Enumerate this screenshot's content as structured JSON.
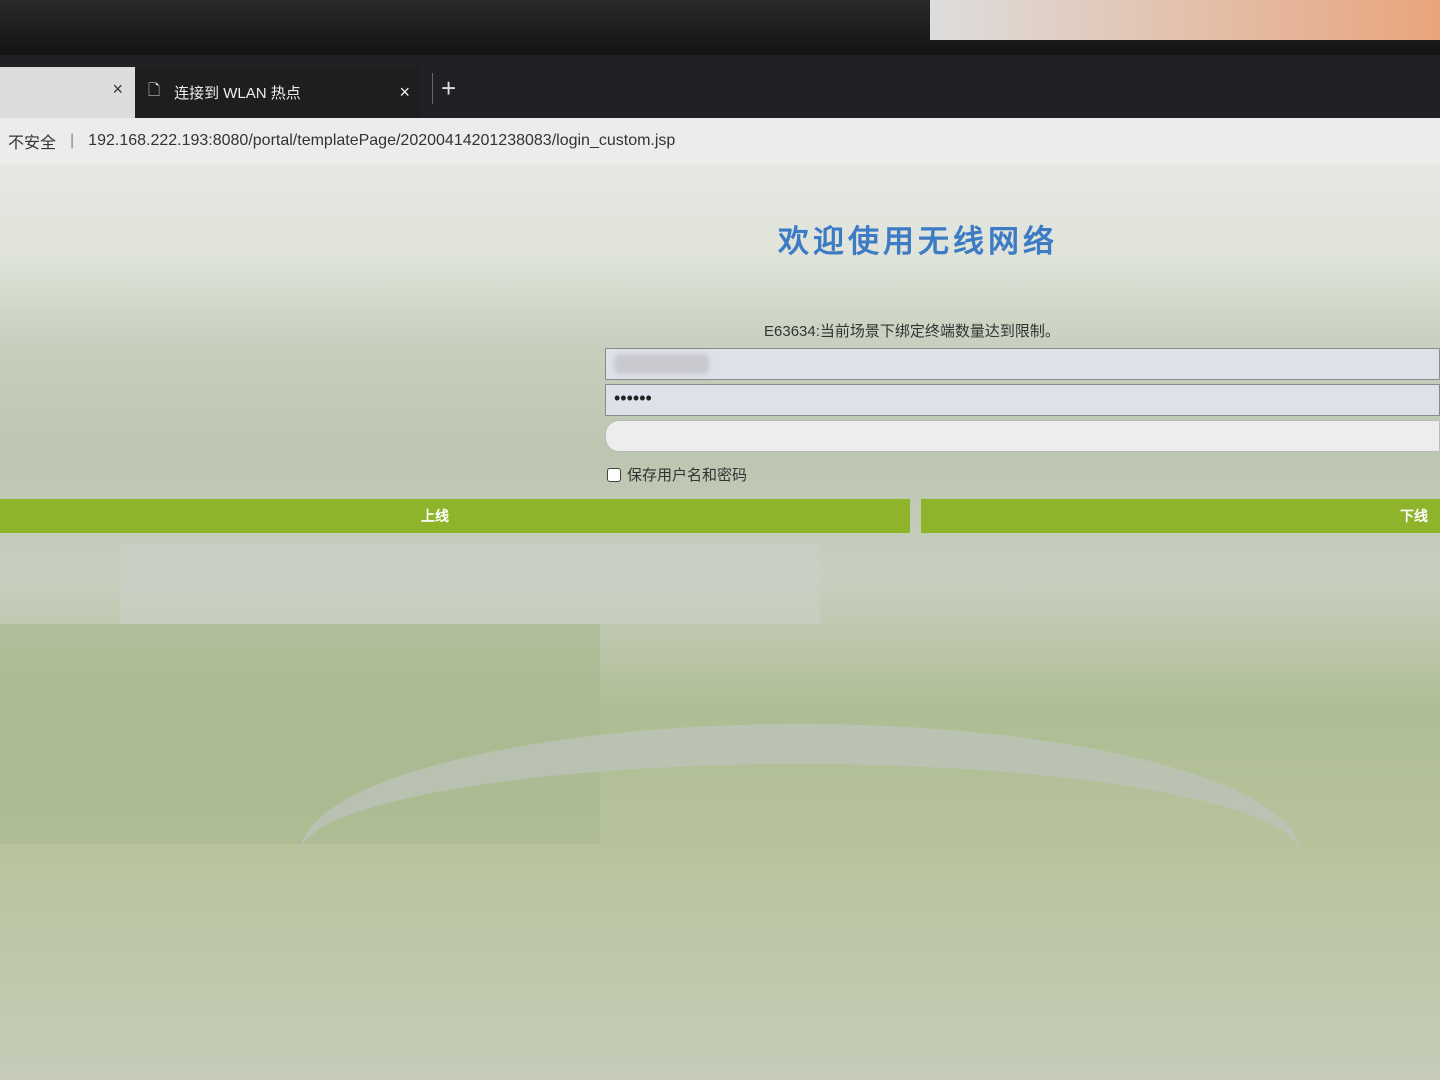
{
  "browser": {
    "tabs": [
      {
        "label": "",
        "close": "×"
      },
      {
        "label": "连接到 WLAN 热点",
        "close": "×",
        "icon": "page-icon"
      }
    ],
    "new_tab": "+",
    "security": "不安全",
    "url": "192.168.222.193:8080/portal/templatePage/20200414201238083/login_custom.jsp"
  },
  "portal": {
    "title": "欢迎使用无线网络",
    "error": "E63634:当前场景下绑定终端数量达到限制。",
    "password_mask": "••••••",
    "remember_label": "保存用户名和密码",
    "login_button": "上线",
    "logout_button": "下线",
    "accent": "#8db42a"
  }
}
